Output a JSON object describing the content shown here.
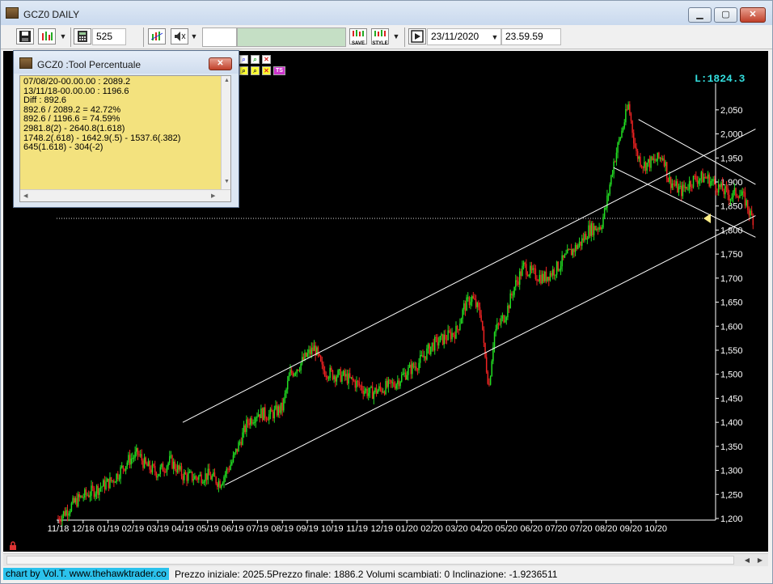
{
  "window": {
    "title": "GCZ0 DAILY",
    "controls": {
      "minimize": "▁",
      "maximize": "▢",
      "close": "✕"
    }
  },
  "toolbar": {
    "bars_count": "525",
    "date": "23/11/2020",
    "time": "23.59.59",
    "save_label": "SAVE",
    "style_label": "STYLE"
  },
  "dialog": {
    "title": "GCZ0 :Tool Percentuale",
    "close": "✕",
    "lines": [
      "07/08/20-00.00.00 : 2089.2",
      "13/11/18-00.00.00 : 1196.6",
      "Diff : 892.6",
      "892.6 / 2089.2 = 42.72%",
      "892.6 / 1196.6 = 74.59%",
      "2981.8(2) - 2640.8(1.618)",
      "1748.2(.618) - 1642.9(.5) - 1537.6(.382)",
      "645(1.618) - 304(-2)"
    ]
  },
  "palette": {
    "ts_label": "TS"
  },
  "chart_data": {
    "type": "candlestick",
    "last_label": "L:1824.3",
    "last_value": 1824.3,
    "ylim": [
      1200,
      2080
    ],
    "y_ticks": [
      1200,
      1250,
      1300,
      1350,
      1400,
      1450,
      1500,
      1550,
      1600,
      1650,
      1700,
      1750,
      1800,
      1850,
      1900,
      1950,
      2000,
      2050
    ],
    "y_tick_labels": [
      "1,200",
      "1,250",
      "1,300",
      "1,350",
      "1,400",
      "1,450",
      "1,500",
      "1,550",
      "1,600",
      "1,650",
      "1,700",
      "1,750",
      "1,800",
      "1,850",
      "1,900",
      "1,950",
      "2,000",
      "2,050"
    ],
    "x_tick_labels": [
      "11/18",
      "12/18",
      "01/19",
      "02/19",
      "03/19",
      "04/19",
      "05/19",
      "06/19",
      "07/19",
      "08/19",
      "09/19",
      "10/19",
      "11/19",
      "12/19",
      "01/20",
      "02/20",
      "03/20",
      "04/20",
      "05/20",
      "06/20",
      "07/20",
      "07/20",
      "08/20",
      "09/20",
      "10/20"
    ],
    "price_path": [
      [
        0,
        1200
      ],
      [
        0.3,
        1215
      ],
      [
        0.8,
        1240
      ],
      [
        1.5,
        1260
      ],
      [
        2.2,
        1280
      ],
      [
        2.8,
        1320
      ],
      [
        3.2,
        1335
      ],
      [
        3.5,
        1310
      ],
      [
        4,
        1295
      ],
      [
        4.5,
        1320
      ],
      [
        5,
        1290
      ],
      [
        5.5,
        1285
      ],
      [
        6,
        1290
      ],
      [
        6.5,
        1275
      ],
      [
        7,
        1320
      ],
      [
        7.3,
        1360
      ],
      [
        7.6,
        1400
      ],
      [
        8,
        1420
      ],
      [
        8.5,
        1415
      ],
      [
        9,
        1430
      ],
      [
        9.3,
        1500
      ],
      [
        9.7,
        1520
      ],
      [
        10,
        1540
      ],
      [
        10.3,
        1555
      ],
      [
        10.6,
        1510
      ],
      [
        11,
        1500
      ],
      [
        11.5,
        1495
      ],
      [
        12,
        1480
      ],
      [
        12.5,
        1460
      ],
      [
        13,
        1470
      ],
      [
        13.5,
        1480
      ],
      [
        14,
        1505
      ],
      [
        14.5,
        1525
      ],
      [
        15,
        1560
      ],
      [
        15.5,
        1575
      ],
      [
        16,
        1590
      ],
      [
        16.3,
        1640
      ],
      [
        16.6,
        1660
      ],
      [
        17,
        1620
      ],
      [
        17.1,
        1550
      ],
      [
        17.3,
        1475
      ],
      [
        17.5,
        1585
      ],
      [
        18,
        1630
      ],
      [
        18.3,
        1680
      ],
      [
        18.7,
        1725
      ],
      [
        19,
        1710
      ],
      [
        19.5,
        1700
      ],
      [
        20,
        1720
      ],
      [
        20.5,
        1750
      ],
      [
        21,
        1775
      ],
      [
        21.3,
        1800
      ],
      [
        21.8,
        1810
      ],
      [
        22,
        1850
      ],
      [
        22.3,
        1940
      ],
      [
        22.6,
        2000
      ],
      [
        22.9,
        2060
      ],
      [
        23.2,
        1960
      ],
      [
        23.5,
        1935
      ],
      [
        24,
        1945
      ],
      [
        24.3,
        1955
      ],
      [
        24.5,
        1905
      ],
      [
        25,
        1880
      ],
      [
        25.5,
        1905
      ],
      [
        26,
        1910
      ],
      [
        26.5,
        1890
      ],
      [
        27,
        1870
      ],
      [
        27.3,
        1880
      ],
      [
        27.6,
        1860
      ],
      [
        27.8,
        1830
      ],
      [
        27.9,
        1824.3
      ]
    ],
    "trend_lines": [
      {
        "x1": 5,
        "y1": 1400,
        "x2": 28,
        "y2": 2010
      },
      {
        "x1": 6.7,
        "y1": 1270,
        "x2": 28,
        "y2": 1830
      },
      {
        "x1": 23.3,
        "y1": 2030,
        "x2": 28,
        "y2": 1895
      },
      {
        "x1": 22.3,
        "y1": 1930,
        "x2": 28,
        "y2": 1785
      }
    ],
    "horizontal_line": 1824.3,
    "colors": {
      "up": "#22dd22",
      "down": "#ee2222",
      "lines": "#ffffff",
      "last": "#33dddd",
      "marker": "#ffee88"
    }
  },
  "status": {
    "credit": "chart by Vol.T. www.thehawktrader.co",
    "text": "Prezzo iniziale: 2025.5Prezzo finale: 1886.2 Volumi scambiati: 0 Inclinazione: -1.9236511"
  }
}
